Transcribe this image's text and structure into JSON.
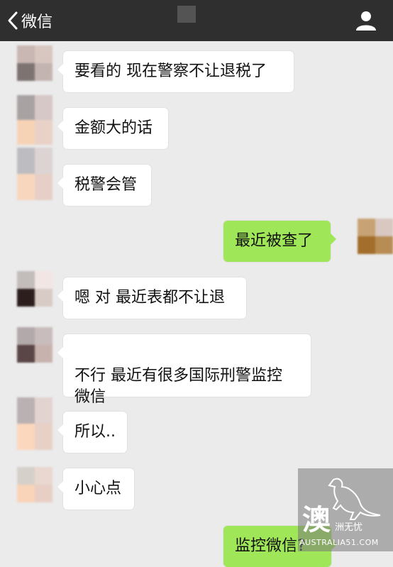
{
  "header": {
    "back_label": "微信",
    "back_icon": "chevron-left-icon",
    "profile_icon": "person-icon",
    "background": "#2f2f2f"
  },
  "messages": [
    {
      "side": "in",
      "text": "要看的 现在警察不让退税了"
    },
    {
      "side": "in",
      "text": "金额大的话"
    },
    {
      "side": "in",
      "text": "税警会管"
    },
    {
      "side": "out",
      "text": "最近被查了"
    },
    {
      "side": "in",
      "text": "嗯 对 最近表都不让退"
    },
    {
      "side": "in",
      "text": "不行 最近有很多国际刑警监控\n微信"
    },
    {
      "side": "in",
      "text": "所以.."
    },
    {
      "side": "in",
      "text": "小心点"
    },
    {
      "side": "out",
      "text": "监控微信?"
    }
  ],
  "watermark": {
    "char": "澳",
    "sub": "洲无忧",
    "domain": "AUSTRALIA51.COM"
  },
  "colors": {
    "background": "#ebebeb",
    "incoming_bubble": "#ffffff",
    "outgoing_bubble": "#9fe658"
  }
}
